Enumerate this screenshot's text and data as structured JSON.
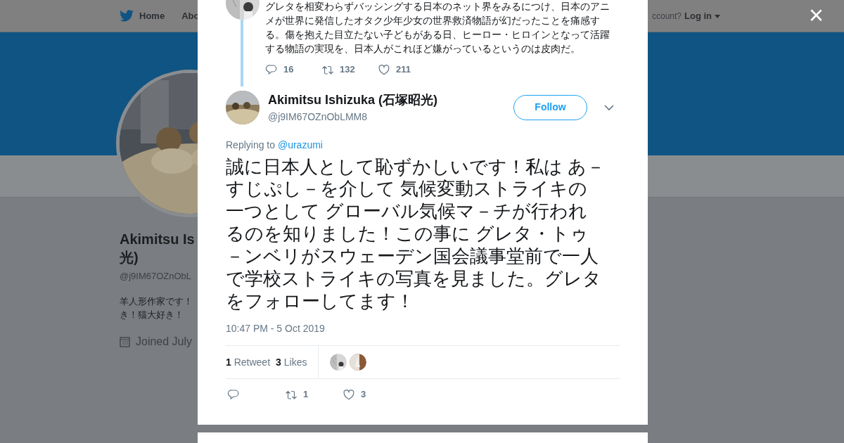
{
  "background_page": {
    "nav": [
      {
        "label": "Home",
        "kind": "home"
      },
      {
        "label": "Abo",
        "kind": "plain"
      }
    ],
    "account_prompt": "ccount?",
    "login": "Log in",
    "profile_name_lines": [
      "Akimitsu Is",
      "光)"
    ],
    "profile_handle": "@j9IM67OZnObL",
    "bio_lines": [
      "羊人形作家です！",
      "き！猫大好き！"
    ],
    "joined": "Joined July"
  },
  "modal": {
    "close": "×",
    "parent_tweet": {
      "text": "グレタを相変わらずバッシングする日本のネット界をみるにつけ、日本のアニメが世界に発信したオタク少年少女の世界救済物語が幻だったことを痛感する。傷を抱えた目立たない子どもがある日、ヒーロー・ヒロインとなって活躍する物語の実現を、日本人がこれほど嫌がっているというのは皮肉だ。",
      "replies": "16",
      "retweets": "132",
      "likes": "211"
    },
    "tweet": {
      "name": "Akimitsu Ishizuka (石塚昭光)",
      "handle": "@j9IM67OZnObLMM8",
      "follow": "Follow",
      "replying_label": "Replying to",
      "replying_to": "@urazumi",
      "text": "誠に日本人として恥ずかしいです！私は あ－すじぷし－を介して 気候変動ストライキの一つとして グローバル気候マ－チが行われるのを知りました！この事に グレタ・トゥ－ンベリがスウェーデン国会議事堂前で一人で学校ストライキの写真を見ました。グレタをフォローしてます！",
      "time": "10:47 PM - 5 Oct 2019",
      "stats": [
        {
          "count": "1",
          "label": "Retweet"
        },
        {
          "count": "3",
          "label": "Likes"
        }
      ],
      "actions": [
        {
          "kind": "reply"
        },
        {
          "kind": "retweet",
          "count": "1"
        },
        {
          "kind": "like",
          "count": "3"
        }
      ]
    }
  }
}
